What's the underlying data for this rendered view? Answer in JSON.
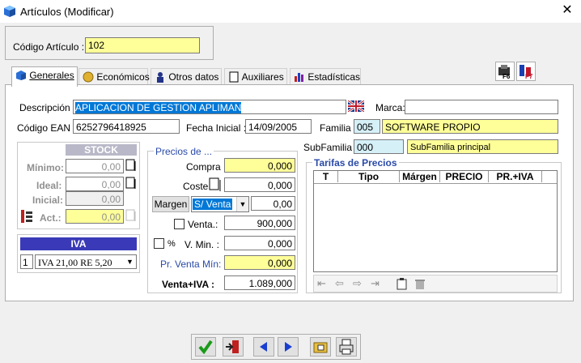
{
  "window": {
    "title": "Artículos (Modificar)",
    "close": "✕"
  },
  "code": {
    "label": "Código Artículo :",
    "value": "102"
  },
  "tabs": [
    {
      "label": "Generales"
    },
    {
      "label": "Económicos"
    },
    {
      "label": "Otros datos"
    },
    {
      "label": "Auxiliares"
    },
    {
      "label": "Estadísticas"
    }
  ],
  "form": {
    "descripcion_label": "Descripción :",
    "descripcion": "APLICACION DE GESTION APLIMAN",
    "marca_label": "Marca:",
    "marca": "",
    "ean_label": "Código EAN :",
    "ean": "6252796418925",
    "fecha_label": "Fecha Inicial :",
    "fecha": "14/09/2005",
    "familia_label": "Familia :",
    "familia_code": "005",
    "familia_name": "SOFTWARE PROPIO",
    "subfamilia_label": "SubFamilia :",
    "subfamilia_code": "000",
    "subfamilia_name": "SubFamilia principal"
  },
  "stock": {
    "title": "STOCK",
    "minimo_label": "Mínimo:",
    "minimo": "0,00",
    "ideal_label": "Ideal:",
    "ideal": "0,00",
    "inicial_label": "Inicial:",
    "inicial": "0,00",
    "act_label": "Act.:",
    "act": "0,00"
  },
  "iva": {
    "title": "IVA",
    "num": "1",
    "value": "IVA 21,00 RE  5,20"
  },
  "precios": {
    "title": "Precios de ...",
    "compra_label": "Compra :",
    "compra": "0,000",
    "coste_label": "Coste :",
    "coste": "0,000",
    "margen_btn": "Margen",
    "margen_type": "S/ Venta",
    "margen_value": "0,00",
    "venta_label": "Venta.:",
    "venta": "900,000",
    "pct_label": "%",
    "vmin_label": "V. Min. :",
    "vmin": "0,000",
    "prventa_label": "Pr. Venta Mín:",
    "prventa": "0,000",
    "ventaiva_label": "Venta+IVA :",
    "ventaiva": "1.089,000"
  },
  "tarifas": {
    "title": "Tarifas de Precios",
    "columns": [
      "T",
      "Tipo",
      "Márgen",
      "PRECIO",
      "PR.+IVA"
    ]
  },
  "colors": {
    "yellow": "#ffff99",
    "selection": "#0078d7",
    "iva_header": "#3a3ab8"
  }
}
